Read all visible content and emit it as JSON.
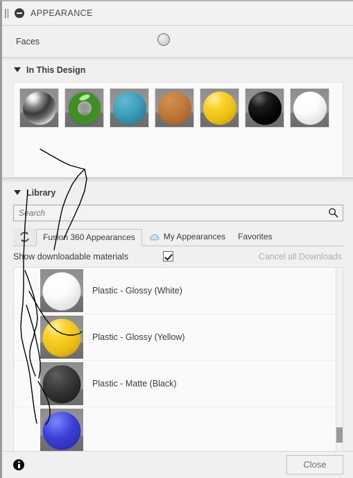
{
  "titlebar": {
    "title": "APPEARANCE",
    "collapse_icon": "minus-circle-icon",
    "grip_icon": "drag-grip-icon"
  },
  "faces": {
    "label": "Faces",
    "swatch_icon": "material-sphere-swatch"
  },
  "in_this_design": {
    "header": "In This Design",
    "expanded": true,
    "swatches": [
      {
        "name": "chrome-polished",
        "shape": "sphere",
        "color": "#8a8a8a"
      },
      {
        "name": "glass-green",
        "shape": "torus",
        "color": "#3f8f22"
      },
      {
        "name": "paint-teal",
        "shape": "sphere",
        "color": "#3d9fbb"
      },
      {
        "name": "paint-orange",
        "shape": "sphere",
        "color": "#c07a3a"
      },
      {
        "name": "plastic-glossy-yellow",
        "shape": "sphere",
        "color": "#fbd32c"
      },
      {
        "name": "plastic-glossy-black",
        "shape": "sphere",
        "color": "#0b0b0b"
      },
      {
        "name": "plastic-glossy-white",
        "shape": "sphere",
        "color": "#f4f4f4"
      }
    ]
  },
  "library": {
    "header": "Library",
    "expanded": true,
    "search": {
      "value": "",
      "placeholder": "Search",
      "icon": "search-icon"
    },
    "refresh_icon": "refresh-icon",
    "tabs": [
      {
        "label": "Fusion 360 Appearances",
        "active": true,
        "icon": null
      },
      {
        "label": "My Appearances",
        "active": false,
        "icon": "cloud-icon"
      },
      {
        "label": "Favorites",
        "active": false,
        "icon": null
      }
    ],
    "options": {
      "show_downloadable_label": "Show downloadable materials",
      "show_downloadable_checked": true,
      "cancel_all_downloads": "Cancel all Downloads",
      "cancel_all_downloads_enabled": false
    },
    "materials": [
      {
        "label": "Plastic - Glossy (White)",
        "swatch": "b-white"
      },
      {
        "label": "Plastic - Glossy (Yellow)",
        "swatch": "b-yellow"
      },
      {
        "label": "Plastic - Matte (Black)",
        "swatch": "b-matte-black"
      },
      {
        "label": "",
        "swatch": "b-blue"
      }
    ]
  },
  "footer": {
    "info_icon": "info-icon",
    "close_label": "Close"
  },
  "colors": {
    "panel_bg": "#f0f0f0",
    "list_bg": "#fafafa",
    "text": "#3c3c3c",
    "disabled_text": "#b0b0b0",
    "border": "#c4c4c4",
    "annotation_ink": "#000000"
  }
}
